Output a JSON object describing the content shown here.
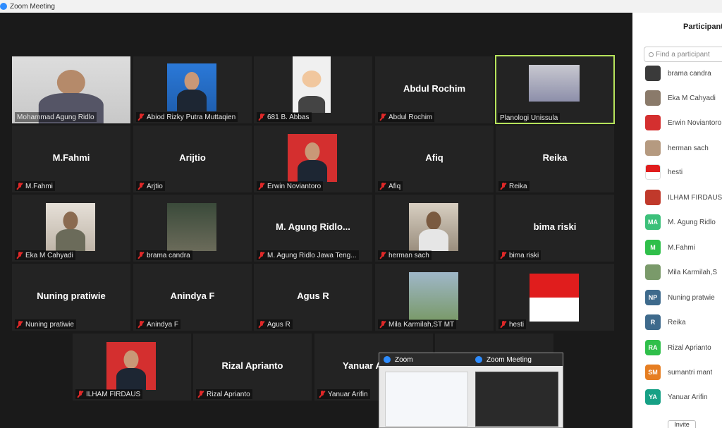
{
  "window": {
    "title": "Zoom Meeting"
  },
  "tiles": [
    {
      "label": "Mohammad Agung Ridlo",
      "center": "",
      "muted": false
    },
    {
      "label": "Abiod Rizky Putra Muttaqien",
      "center": "",
      "muted": true
    },
    {
      "label": "681 B. Abbas",
      "center": "",
      "muted": true
    },
    {
      "label": "Abdul Rochim",
      "center": "Abdul Rochim",
      "muted": true
    },
    {
      "label": "Planologi Unissula",
      "center": "",
      "muted": false
    },
    {
      "label": "M.Fahmi",
      "center": "M.Fahmi",
      "muted": true
    },
    {
      "label": "Arjtio",
      "center": "Arijtio",
      "muted": true
    },
    {
      "label": "Erwin Noviantoro",
      "center": "",
      "muted": true
    },
    {
      "label": "Afiq",
      "center": "Afiq",
      "muted": true
    },
    {
      "label": "Reika",
      "center": "Reika",
      "muted": true
    },
    {
      "label": "Eka M Cahyadi",
      "center": "",
      "muted": true
    },
    {
      "label": "brama candra",
      "center": "",
      "muted": true
    },
    {
      "label": "M. Agung Ridlo Jawa Teng...",
      "center": "M. Agung Ridlo...",
      "muted": true
    },
    {
      "label": "herman sach",
      "center": "",
      "muted": true
    },
    {
      "label": "bima riski",
      "center": "bima riski",
      "muted": true
    },
    {
      "label": "Nuning pratiwie",
      "center": "Nuning pratiwie",
      "muted": true
    },
    {
      "label": "Anindya F",
      "center": "Anindya F",
      "muted": true
    },
    {
      "label": "Agus R",
      "center": "Agus R",
      "muted": true
    },
    {
      "label": "Mila Karmilah,ST MT",
      "center": "",
      "muted": true
    },
    {
      "label": "hesti",
      "center": "",
      "muted": true
    },
    {
      "label": "ILHAM FIRDAUS",
      "center": "",
      "muted": true
    },
    {
      "label": "Rizal Aprianto",
      "center": "Rizal Aprianto",
      "muted": true
    },
    {
      "label": "Yanuar Arifin",
      "center": "Yanuar A",
      "muted": true
    }
  ],
  "popup": {
    "tab1": "Zoom",
    "tab2": "Zoom Meeting"
  },
  "participants_panel": {
    "title": "Participants",
    "search_placeholder": "Find a participant",
    "invite_label": "Invite",
    "items": [
      {
        "name": "brama candra",
        "initials": "",
        "color": "#3a3a3a"
      },
      {
        "name": "Eka M Cahyadi",
        "initials": "",
        "color": "#8a7a6a"
      },
      {
        "name": "Erwin Noviantoro",
        "initials": "",
        "color": "#d42f2f"
      },
      {
        "name": "herman sach",
        "initials": "",
        "color": "#b59a80"
      },
      {
        "name": "hesti",
        "initials": "",
        "color": "#e01d1d"
      },
      {
        "name": "ILHAM FIRDAUS",
        "initials": "",
        "color": "#c0392b"
      },
      {
        "name": "M. Agung Ridlo",
        "initials": "MA",
        "color": "#3cc07a"
      },
      {
        "name": "M.Fahmi",
        "initials": "M",
        "color": "#2fbf4a"
      },
      {
        "name": "Mila Karmilah,S",
        "initials": "",
        "color": "#7a9a6a"
      },
      {
        "name": "Nuning pratwie",
        "initials": "NP",
        "color": "#3e6a8c"
      },
      {
        "name": "Reika",
        "initials": "R",
        "color": "#3e6a8c"
      },
      {
        "name": "Rizal Aprianto",
        "initials": "RA",
        "color": "#2fbf4a"
      },
      {
        "name": "sumantri mant",
        "initials": "SM",
        "color": "#e67e22"
      },
      {
        "name": "Yanuar Arifin",
        "initials": "YA",
        "color": "#16a085"
      }
    ]
  }
}
